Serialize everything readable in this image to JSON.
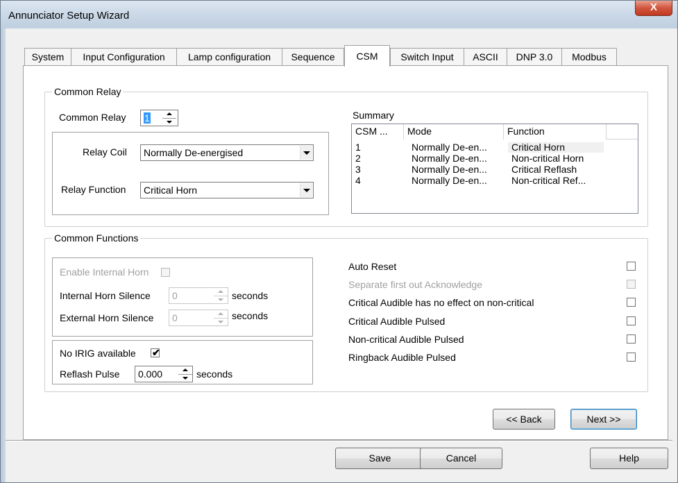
{
  "window": {
    "title": "Annunciator Setup Wizard",
    "close_label": "X"
  },
  "tabs": [
    {
      "label": "System"
    },
    {
      "label": "Input Configuration"
    },
    {
      "label": "Lamp configuration"
    },
    {
      "label": "Sequence"
    },
    {
      "label": "CSM"
    },
    {
      "label": "Switch Input"
    },
    {
      "label": "ASCII"
    },
    {
      "label": "DNP 3.0"
    },
    {
      "label": "Modbus"
    }
  ],
  "common_relay": {
    "group_title": "Common Relay",
    "relay_label": "Common Relay",
    "relay_value": "1",
    "coil_label": "Relay Coil",
    "coil_value": "Normally De-energised",
    "function_label": "Relay Function",
    "function_value": "Critical Horn"
  },
  "summary": {
    "title": "Summary",
    "columns": [
      "CSM ...",
      "Mode",
      "Function"
    ],
    "rows": [
      {
        "csm": "1",
        "mode": "Normally De-en...",
        "function": "Critical Horn"
      },
      {
        "csm": "2",
        "mode": "Normally De-en...",
        "function": "Non-critical Horn"
      },
      {
        "csm": "3",
        "mode": "Normally De-en...",
        "function": "Critical Reflash"
      },
      {
        "csm": "4",
        "mode": "Normally De-en...",
        "function": "Non-critical Ref..."
      }
    ]
  },
  "common_functions": {
    "group_title": "Common Functions",
    "enable_internal_horn": "Enable Internal Horn",
    "internal_horn_silence": "Internal Horn Silence",
    "internal_horn_value": "0",
    "external_horn_silence": "External Horn Silence",
    "external_horn_value": "0",
    "seconds": "seconds",
    "no_irig": "No IRIG available",
    "no_irig_checked": "✔",
    "reflash_pulse": "Reflash Pulse",
    "reflash_value": "0.000",
    "options": [
      {
        "label": "Auto Reset",
        "enabled": true
      },
      {
        "label": "Separate first out Acknowledge",
        "enabled": false
      },
      {
        "label": "Critical Audible has no effect on non-critical",
        "enabled": true
      },
      {
        "label": "Critical Audible Pulsed",
        "enabled": true
      },
      {
        "label": "Non-critical Audible Pulsed",
        "enabled": true
      },
      {
        "label": "Ringback Audible Pulsed",
        "enabled": true
      }
    ]
  },
  "nav": {
    "back": "<< Back",
    "next": "Next >>"
  },
  "footer": {
    "save": "Save",
    "cancel": "Cancel",
    "help": "Help"
  }
}
